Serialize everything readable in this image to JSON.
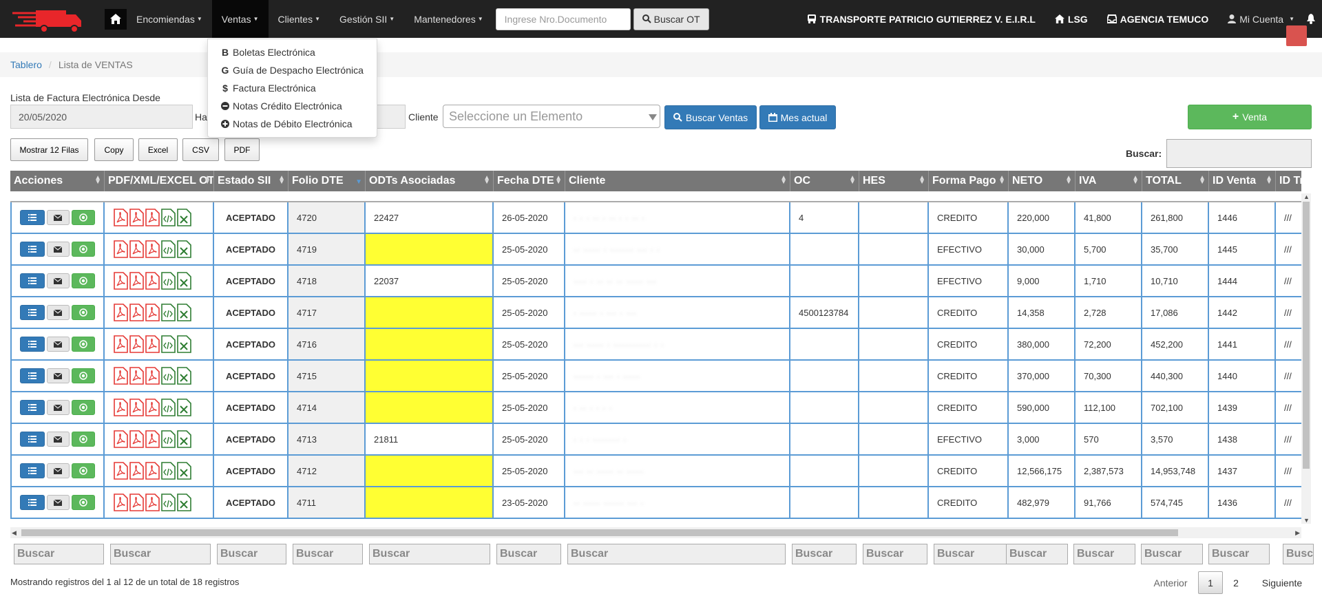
{
  "navbar": {
    "menus": [
      {
        "label": "Encomiendas"
      },
      {
        "label": "Ventas"
      },
      {
        "label": "Clientes"
      },
      {
        "label": "Gestión SII"
      },
      {
        "label": "Mantenedores"
      }
    ],
    "search_placeholder": "Ingrese Nro.Documento",
    "search_button": "Buscar OT",
    "company": "TRANSPORTE PATRICIO GUTIERREZ V. E.I.R.L",
    "branch_code": "LSG",
    "agency": "AGENCIA TEMUCO",
    "account": "Mi Cuenta"
  },
  "ventas_menu": [
    {
      "icon": "B",
      "label": "Boletas Electrónica"
    },
    {
      "icon": "G",
      "label": "Guía de Despacho Electrónica"
    },
    {
      "icon": "$",
      "label": "Factura Electrónica"
    },
    {
      "icon": "−",
      "label": "Notas Crédito Electrónica"
    },
    {
      "icon": "+",
      "label": "Notas de Débito Electrónica"
    }
  ],
  "breadcrumb": {
    "home": "Tablero",
    "current": "Lista de VENTAS"
  },
  "filters": {
    "desde_label": "Lista de Factura Electrónica Desde",
    "desde_value": "20/05/2020",
    "hasta_label": "Ha",
    "cliente_label": "Cliente",
    "cliente_placeholder": "Seleccione un Elemento",
    "buscar_ventas": "Buscar Ventas",
    "mes_actual": "Mes actual",
    "venta": "Venta"
  },
  "table_buttons": [
    "Mostrar 12 Filas",
    "Copy",
    "Excel",
    "CSV",
    "PDF"
  ],
  "buscar_label": "Buscar:",
  "columns": [
    "Acciones",
    "PDF/XML/EXCEL OT",
    "Estado SII",
    "Folio DTE",
    "ODTs Asociadas",
    "Fecha DTE",
    "Cliente",
    "OC",
    "HES",
    "Forma Pago",
    "NETO",
    "IVA",
    "TOTAL",
    "ID Venta",
    "ID Tra"
  ],
  "rows": [
    {
      "estado": "ACEPTADO",
      "folio": "4720",
      "odt": "22427",
      "fecha": "26-05-2020",
      "cliente": "· · · ·· · ·· · · ·· ·",
      "oc": "4",
      "hes": "",
      "pago": "CREDITO",
      "neto": "220,000",
      "iva": "41,800",
      "total": "261,800",
      "id": "1446",
      "tra": "///"
    },
    {
      "estado": "ACEPTADO",
      "folio": "4719",
      "odt": "",
      "fecha": "25-05-2020",
      "cliente": "·· ····· · ······· ··· · ·",
      "oc": "",
      "hes": "",
      "pago": "EFECTIVO",
      "neto": "30,000",
      "iva": "5,700",
      "total": "35,700",
      "id": "1445",
      "tra": "///"
    },
    {
      "estado": "ACEPTADO",
      "folio": "4718",
      "odt": "22037",
      "fecha": "25-05-2020",
      "cliente": "···· · ·· ·· ·· ····· ···",
      "oc": "",
      "hes": "",
      "pago": "EFECTIVO",
      "neto": "9,000",
      "iva": "1,710",
      "total": "10,710",
      "id": "1444",
      "tra": "///"
    },
    {
      "estado": "ACEPTADO",
      "folio": "4717",
      "odt": "",
      "fecha": "25-05-2020",
      "cliente": "· ····· · ··· · ···",
      "oc": "4500123784",
      "hes": "",
      "pago": "CREDITO",
      "neto": "14,358",
      "iva": "2,728",
      "total": "17,086",
      "id": "1442",
      "tra": "///"
    },
    {
      "estado": "ACEPTADO",
      "folio": "4716",
      "odt": "",
      "fecha": "25-05-2020",
      "cliente": "··· ····· · ··········· · ·",
      "oc": "",
      "hes": "",
      "pago": "CREDITO",
      "neto": "380,000",
      "iva": "72,200",
      "total": "452,200",
      "id": "1441",
      "tra": "///"
    },
    {
      "estado": "ACEPTADO",
      "folio": "4715",
      "odt": "",
      "fecha": "25-05-2020",
      "cliente": "······ · ··· · ·····",
      "oc": "",
      "hes": "",
      "pago": "CREDITO",
      "neto": "370,000",
      "iva": "70,300",
      "total": "440,300",
      "id": "1440",
      "tra": "///"
    },
    {
      "estado": "ACEPTADO",
      "folio": "4714",
      "odt": "",
      "fecha": "25-05-2020",
      "cliente": "· ·· · · · ·",
      "oc": "",
      "hes": "",
      "pago": "CREDITO",
      "neto": "590,000",
      "iva": "112,100",
      "total": "702,100",
      "id": "1439",
      "tra": "///"
    },
    {
      "estado": "ACEPTADO",
      "folio": "4713",
      "odt": "21811",
      "fecha": "25-05-2020",
      "cliente": "· · · ········ ·",
      "oc": "",
      "hes": "",
      "pago": "EFECTIVO",
      "neto": "3,000",
      "iva": "570",
      "total": "3,570",
      "id": "1438",
      "tra": "///"
    },
    {
      "estado": "ACEPTADO",
      "folio": "4712",
      "odt": "",
      "fecha": "25-05-2020",
      "cliente": "··· ·· ····· ·· ·····",
      "oc": "",
      "hes": "",
      "pago": "CREDITO",
      "neto": "12,566,175",
      "iva": "2,387,573",
      "total": "14,953,748",
      "id": "1437",
      "tra": "///"
    },
    {
      "estado": "ACEPTADO",
      "folio": "4711",
      "odt": "",
      "fecha": "23-05-2020",
      "cliente": "·· ····· ······ ··· ·",
      "oc": "",
      "hes": "",
      "pago": "CREDITO",
      "neto": "482,979",
      "iva": "91,766",
      "total": "574,745",
      "id": "1436",
      "tra": "///"
    }
  ],
  "footer_search": "Buscar",
  "info": "Mostrando registros del 1 al 12 de un total de 18 registros",
  "pagination": {
    "prev": "Anterior",
    "pages": [
      "1",
      "2"
    ],
    "next": "Siguiente"
  },
  "colors": {
    "navbar": "#222222",
    "primary": "#337ab7",
    "success": "#5cb85c",
    "accepted": "#2ea12e",
    "highlight": "#ffff33",
    "row_border": "#5b9bd5"
  }
}
